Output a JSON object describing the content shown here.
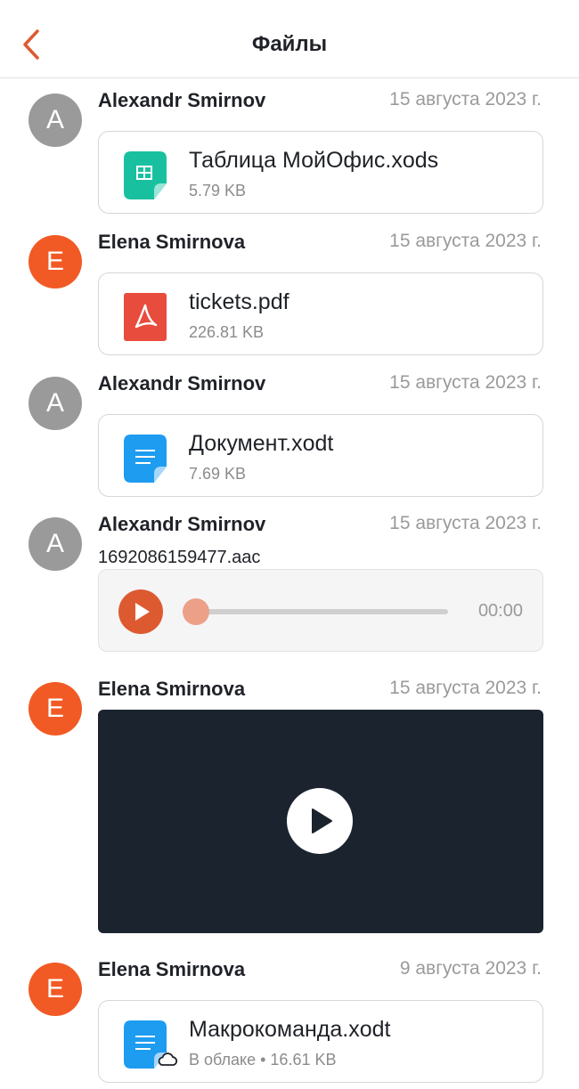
{
  "header": {
    "title": "Файлы"
  },
  "messages": [
    {
      "avatar": "A",
      "author": "Alexandr Smirnov",
      "date": "15 августа 2023 г.",
      "file": {
        "name": "Таблица МойОфис.xods",
        "size": "5.79 KB",
        "icon": "spreadsheet-file-icon"
      }
    },
    {
      "avatar": "E",
      "author": "Elena Smirnova",
      "date": "15 августа 2023 г.",
      "file": {
        "name": "tickets.pdf",
        "size": "226.81 KB",
        "icon": "pdf-file-icon"
      }
    },
    {
      "avatar": "A",
      "author": "Alexandr Smirnov",
      "date": "15 августа 2023 г.",
      "file": {
        "name": "Документ.xodt",
        "size": "7.69 KB",
        "icon": "text-document-file-icon"
      }
    },
    {
      "avatar": "A",
      "author": "Alexandr Smirnov",
      "date": "15 августа 2023 г.",
      "audio": {
        "name": "1692086159477.aac",
        "time": "00:00",
        "progress": 0
      }
    },
    {
      "avatar": "E",
      "author": "Elena Smirnova",
      "date": "15 августа 2023 г.",
      "video": {
        "icon": "play-icon"
      }
    },
    {
      "avatar": "E",
      "author": "Elena Smirnova",
      "date": "9 августа 2023 г.",
      "file": {
        "name": "Макрокоманда.xodt",
        "size": "В облаке • 16.61 KB",
        "icon": "text-document-file-icon",
        "badge": "cloud-icon"
      }
    }
  ],
  "colors": {
    "accent": "#dd5a31",
    "avatar_gray": "#9a9a9a",
    "avatar_orange": "#f15a24",
    "video_bg": "#1a232e"
  }
}
